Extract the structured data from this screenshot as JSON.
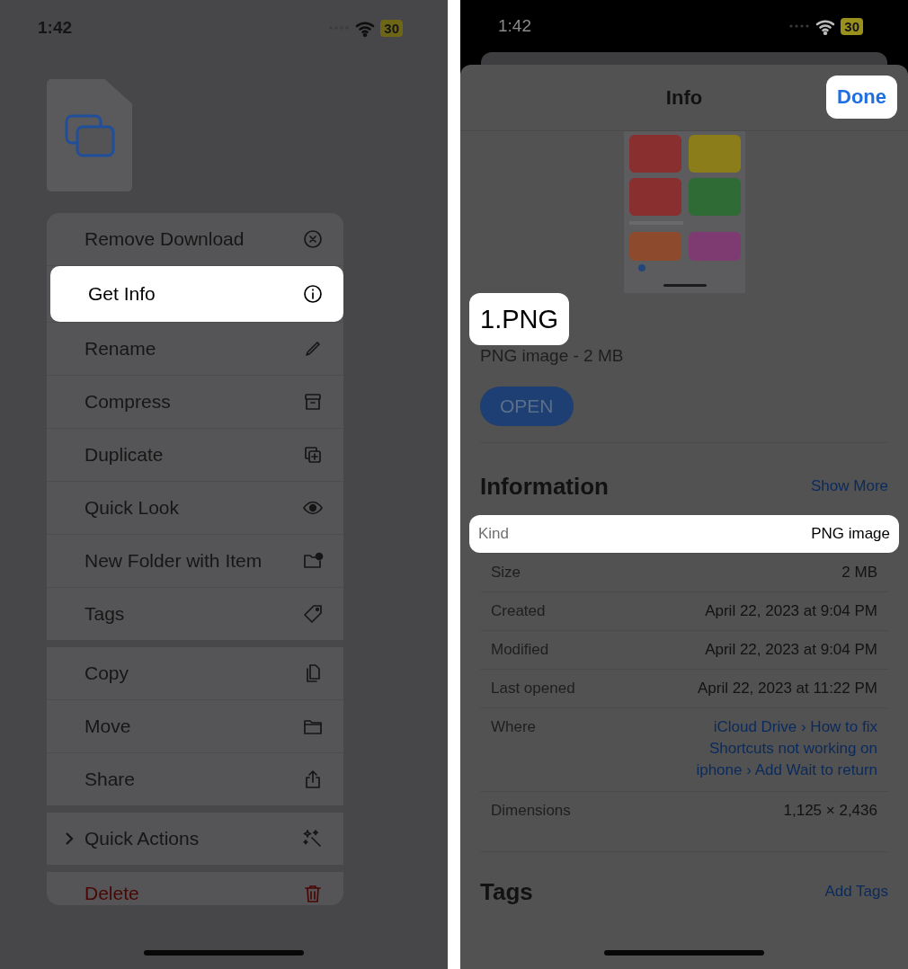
{
  "left_screen": {
    "status_bar": {
      "time": "1:42",
      "battery": "30"
    },
    "context_menu": {
      "groups": [
        {
          "items": [
            {
              "label": "Remove Download",
              "kind": "normal",
              "highlighted": false
            },
            {
              "label": "Get Info",
              "kind": "normal",
              "highlighted": true
            },
            {
              "label": "Rename",
              "kind": "normal",
              "highlighted": false
            },
            {
              "label": "Compress",
              "kind": "normal",
              "highlighted": false
            },
            {
              "label": "Duplicate",
              "kind": "normal",
              "highlighted": false
            },
            {
              "label": "Quick Look",
              "kind": "normal",
              "highlighted": false
            },
            {
              "label": "New Folder with Item",
              "kind": "normal",
              "highlighted": false
            },
            {
              "label": "Tags",
              "kind": "normal",
              "highlighted": false
            }
          ]
        },
        {
          "items": [
            {
              "label": "Copy",
              "kind": "normal",
              "highlighted": false
            },
            {
              "label": "Move",
              "kind": "normal",
              "highlighted": false
            },
            {
              "label": "Share",
              "kind": "normal",
              "highlighted": false
            }
          ]
        },
        {
          "items": [
            {
              "label": "Quick Actions",
              "kind": "submenu",
              "highlighted": false
            }
          ]
        },
        {
          "items": [
            {
              "label": "Delete",
              "kind": "destructive",
              "highlighted": false
            }
          ]
        }
      ]
    }
  },
  "right_screen": {
    "status_bar": {
      "time": "1:42",
      "battery": "30"
    },
    "sheet": {
      "title": "Info",
      "done_button": {
        "label": "Done",
        "highlighted": true
      }
    },
    "file": {
      "name": "1.PNG",
      "name_highlighted": true,
      "subtitle": "PNG image - 2 MB",
      "open_button": "OPEN"
    },
    "information": {
      "heading": "Information",
      "action": "Show More",
      "rows": [
        {
          "label": "Kind",
          "value": "PNG image",
          "kind": "text",
          "highlighted": true
        },
        {
          "label": "Size",
          "value": "2 MB",
          "kind": "text",
          "highlighted": false
        },
        {
          "label": "Created",
          "value": "April 22, 2023 at 9:04 PM",
          "kind": "text",
          "highlighted": false
        },
        {
          "label": "Modified",
          "value": "April 22, 2023 at 9:04 PM",
          "kind": "text",
          "highlighted": false
        },
        {
          "label": "Last opened",
          "value": "April 22, 2023 at 11:22 PM",
          "kind": "text",
          "highlighted": false
        },
        {
          "label": "Where",
          "value": "iCloud Drive › How to fix Shortcuts not working on iphone › Add Wait to return",
          "kind": "link",
          "highlighted": false
        },
        {
          "label": "Dimensions",
          "value": "1,125 × 2,436",
          "kind": "text",
          "highlighted": false
        }
      ]
    },
    "tags": {
      "heading": "Tags",
      "action": "Add Tags"
    }
  }
}
